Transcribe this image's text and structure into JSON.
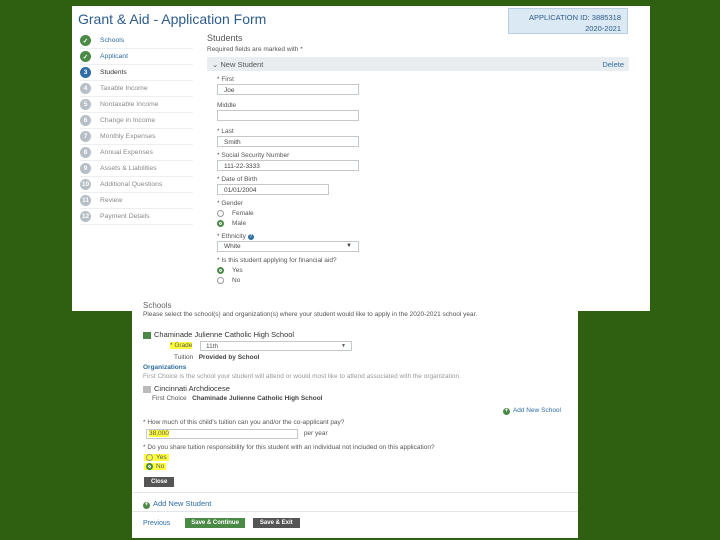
{
  "header": {
    "title": "Grant & Aid - Application Form",
    "application_id": "APPLICATION ID: 3885318",
    "year": "2020-2021"
  },
  "sidebar": {
    "items": [
      {
        "num": "",
        "label": "Schools",
        "status": "done"
      },
      {
        "num": "",
        "label": "Applicant",
        "status": "done"
      },
      {
        "num": "3",
        "label": "Students",
        "status": "active"
      },
      {
        "num": "4",
        "label": "Taxable Income",
        "status": "todo"
      },
      {
        "num": "5",
        "label": "Nontaxable Income",
        "status": "todo"
      },
      {
        "num": "6",
        "label": "Change in Income",
        "status": "todo"
      },
      {
        "num": "7",
        "label": "Monthly Expenses",
        "status": "todo"
      },
      {
        "num": "8",
        "label": "Annual Expenses",
        "status": "todo"
      },
      {
        "num": "9",
        "label": "Assets & Liabilities",
        "status": "todo"
      },
      {
        "num": "10",
        "label": "Additional Questions",
        "status": "todo"
      },
      {
        "num": "11",
        "label": "Review",
        "status": "todo"
      },
      {
        "num": "12",
        "label": "Payment Details",
        "status": "todo"
      }
    ]
  },
  "form": {
    "heading": "Students",
    "required_note": "Required fields are marked with *",
    "panel_title": "New Student",
    "delete_label": "Delete",
    "first_label": "* First",
    "first_value": "Joe",
    "middle_label": "Middle",
    "middle_value": "",
    "last_label": "* Last",
    "last_value": "Smith",
    "ssn_label": "* Social Security Number",
    "ssn_value": "111-22-3333",
    "dob_label": "* Date of Birth",
    "dob_value": "01/01/2004",
    "gender_label": "* Gender",
    "gender_female": "Female",
    "gender_male": "Male",
    "ethnicity_label": "* Ethnicity",
    "ethnicity_value": "White",
    "aid_label": "* Is this student applying for financial aid?",
    "aid_yes": "Yes",
    "aid_no": "No"
  },
  "schools": {
    "heading": "Schools",
    "instruction": "Please select the school(s) and organization(s) where your student would like to apply in the 2020-2021 school year.",
    "school1": "Chaminade Julienne Catholic High School",
    "grade_label": "* Grade",
    "grade_value": "11th",
    "tuition_label": "Tuition",
    "tuition_value": "Provided by School",
    "organizations_label": "Organizations",
    "first_choice_note": "First Choice is the school your student will attend or would most like to attend associated with the organization.",
    "org1": "Cincinnati Archdiocese",
    "first_choice_label": "First Choice",
    "first_choice_value": "Chaminade Julienne Catholic High School",
    "add_school": "Add New School",
    "tuition_question": "* How much of this child's tuition can you and/or the co-applicant pay?",
    "tuition_amount": "38,000",
    "per_year": "per year",
    "share_question": "* Do you share tuition responsibility for this student with an individual not included on this application?",
    "share_yes": "Yes",
    "share_no": "No",
    "close_label": "Close",
    "add_student": "Add New Student",
    "previous_label": "Previous",
    "save_continue": "Save & Continue",
    "save_exit": "Save & Exit"
  }
}
